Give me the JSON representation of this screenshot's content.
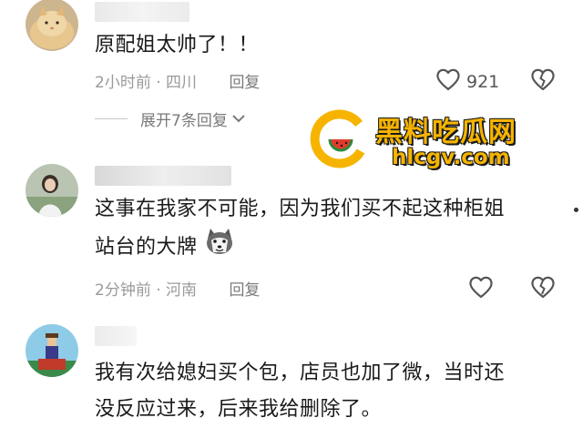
{
  "comments": [
    {
      "text": "原配姐太帅了！！",
      "time_location": "2小时前 · 四川",
      "reply_label": "回复",
      "like_count": "921"
    },
    {
      "text_line1": "这事在我家不可能，因为我们买不起这种柜姐",
      "text_line2": "站台的大牌",
      "time_location": "2分钟前 · 河南",
      "reply_label": "回复"
    },
    {
      "text_line1": "我有次给媳妇买个包，店员也加了微，当时还",
      "text_line2": "没反应过来，后来我给删除了。"
    }
  ],
  "expand": {
    "label": "展开7条回复"
  },
  "watermark": {
    "title": "黑料吃瓜网",
    "url": "hlcgv.com"
  },
  "icons": {
    "like": "heart-outline-icon",
    "dislike": "broken-heart-icon",
    "expand": "chevron-down-icon",
    "emoji": "husky-dog-emoji"
  },
  "colors": {
    "watermark": "#f6b400",
    "meta_text": "#9a9a9a",
    "body_text": "#1a1a1a"
  }
}
